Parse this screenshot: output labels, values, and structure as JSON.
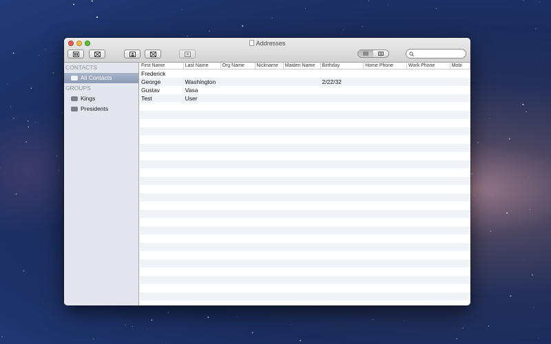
{
  "window": {
    "title": "Addresses"
  },
  "toolbar": {
    "buttons": [
      {
        "name": "card-view-icon"
      },
      {
        "name": "delete-card-icon"
      },
      {
        "name": "person-icon"
      },
      {
        "name": "remove-person-icon"
      },
      {
        "name": "photo-icon"
      }
    ],
    "view_toggle": {
      "list": "list-view-icon",
      "columns": "column-view-icon",
      "selected": "list"
    },
    "search": {
      "placeholder": "",
      "value": ""
    }
  },
  "sidebar": {
    "contacts_header": "CONTACTS",
    "all_contacts": "All Contacts",
    "groups_header": "GROUPS",
    "groups": [
      "Kings",
      "Presidents"
    ]
  },
  "table": {
    "columns": [
      "First Name",
      "Last Name",
      "Org Name",
      "Nickname",
      "Maiden Name",
      "Birthday",
      "Home Phone",
      "Work Phone",
      "Mobi"
    ],
    "rows": [
      [
        "Frederick",
        "",
        "",
        "",
        "",
        "",
        "",
        "",
        ""
      ],
      [
        "George",
        "Washington",
        "",
        "",
        "",
        "2/22/32",
        "",
        "",
        ""
      ],
      [
        "Gustav",
        "Vasa",
        "",
        "",
        "",
        "",
        "",
        "",
        ""
      ],
      [
        "Test",
        "User",
        "",
        "",
        "",
        "",
        "",
        "",
        ""
      ]
    ]
  },
  "colors": {
    "selection": "#98a7c0",
    "sidebar_bg": "#e3e7ed",
    "stripe": "#f0f3f8"
  }
}
